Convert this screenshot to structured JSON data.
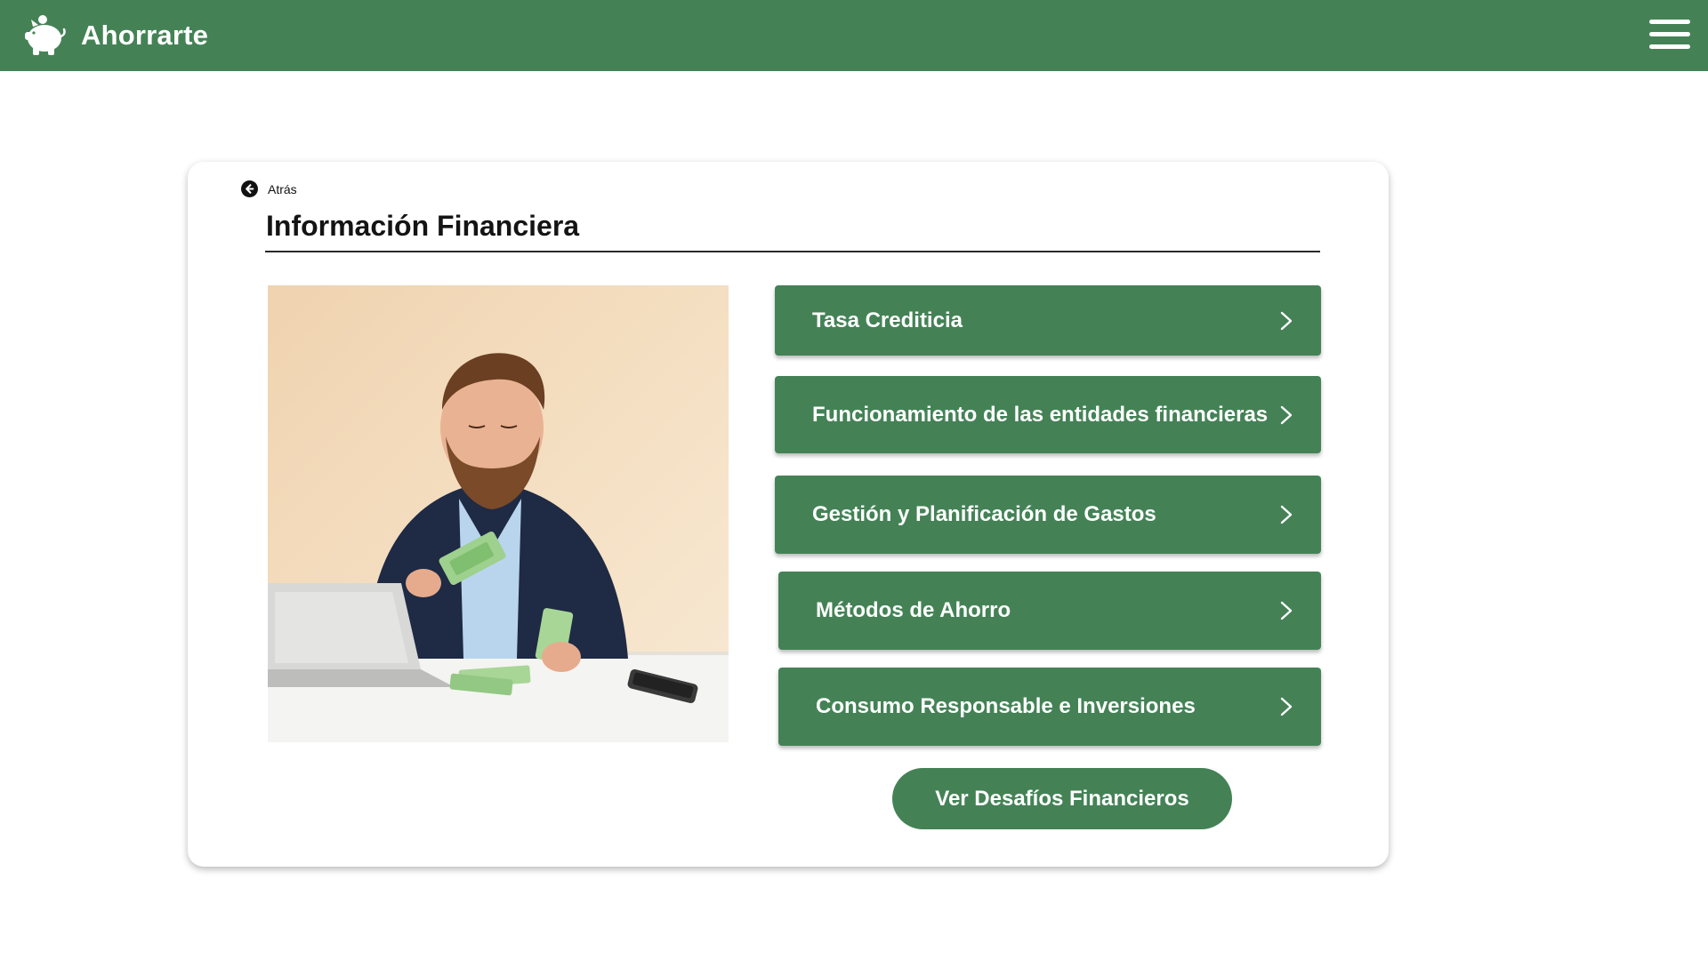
{
  "app": {
    "name": "Ahorrarte",
    "logo_icon": "piggy-bank-icon",
    "menu_icon": "hamburger-menu-icon"
  },
  "colors": {
    "brand_green": "#448256",
    "text_dark": "#141414",
    "background": "#ffffff"
  },
  "back": {
    "label": "Atrás",
    "icon": "arrow-left-circle-icon"
  },
  "page": {
    "title": "Información Financiera"
  },
  "photo": {
    "subject": "man-counting-banknotes-at-desk"
  },
  "topics": [
    {
      "label": "Tasa Crediticia",
      "icon": "chevron-right-icon"
    },
    {
      "label": "Funcionamiento de las entidades financieras",
      "icon": "chevron-right-icon"
    },
    {
      "label": "Gestión y Planificación de Gastos",
      "icon": "chevron-right-icon"
    },
    {
      "label": "Métodos de Ahorro",
      "icon": "chevron-right-icon"
    },
    {
      "label": "Consumo Responsable e Inversiones",
      "icon": "chevron-right-icon"
    }
  ],
  "cta": {
    "label": "Ver Desafíos Financieros"
  }
}
